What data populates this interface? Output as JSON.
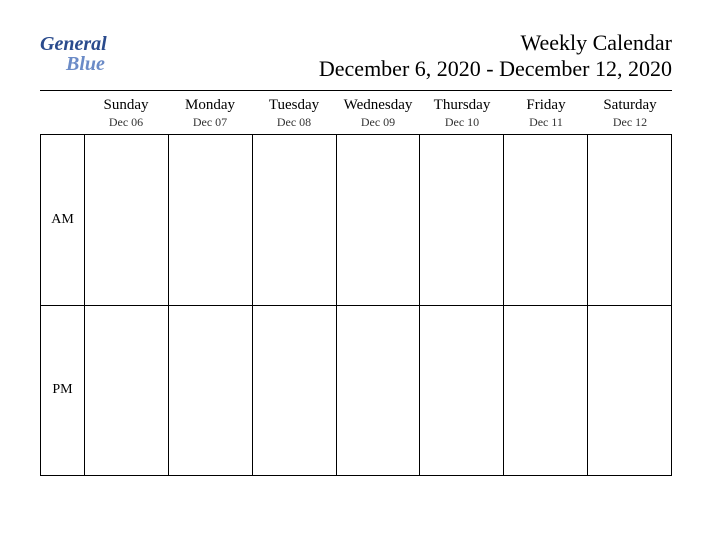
{
  "brand": {
    "part1": "General",
    "part2": "Blue"
  },
  "title": "Weekly Calendar",
  "subtitle": "December 6, 2020 - December 12, 2020",
  "periods": [
    "AM",
    "PM"
  ],
  "days": [
    {
      "name": "Sunday",
      "date": "Dec 06"
    },
    {
      "name": "Monday",
      "date": "Dec 07"
    },
    {
      "name": "Tuesday",
      "date": "Dec 08"
    },
    {
      "name": "Wednesday",
      "date": "Dec 09"
    },
    {
      "name": "Thursday",
      "date": "Dec 10"
    },
    {
      "name": "Friday",
      "date": "Dec 11"
    },
    {
      "name": "Saturday",
      "date": "Dec 12"
    }
  ]
}
